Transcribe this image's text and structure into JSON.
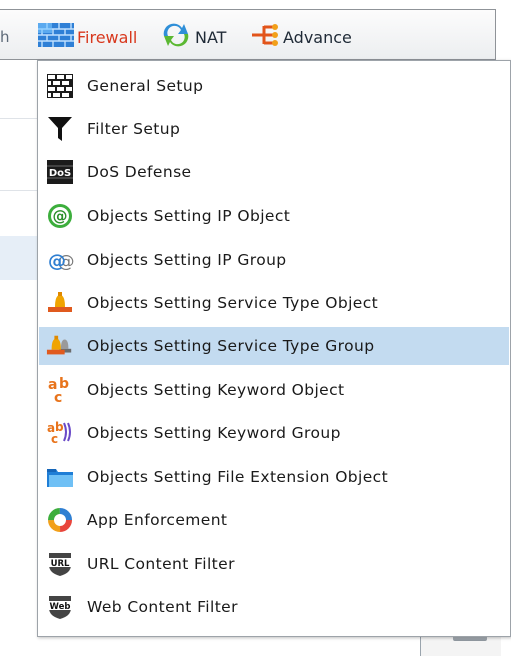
{
  "toolbar": {
    "cut_text": "h",
    "items": [
      {
        "label": "Firewall",
        "icon": "firewall-brick-icon",
        "color": "#d8381d"
      },
      {
        "label": "NAT",
        "icon": "nat-arrows-icon"
      },
      {
        "label": "Advance",
        "icon": "advance-network-icon"
      }
    ]
  },
  "menu": {
    "highlight_color": "#c3dbf0",
    "items": [
      {
        "label": "General Setup",
        "icon": "brick-wall-icon"
      },
      {
        "label": "Filter Setup",
        "icon": "funnel-icon"
      },
      {
        "label": "DoS Defense",
        "icon": "dos-icon"
      },
      {
        "label": "Objects Setting IP Object",
        "icon": "at-sign-icon"
      },
      {
        "label": "Objects Setting IP Group",
        "icon": "at-group-icon"
      },
      {
        "label": "Objects Setting Service Type Object",
        "icon": "bell-icon"
      },
      {
        "label": "Objects Setting Service Type Group",
        "icon": "bell-group-icon",
        "highlighted": true
      },
      {
        "label": "Objects Setting Keyword Object",
        "icon": "abc-icon"
      },
      {
        "label": "Objects Setting Keyword Group",
        "icon": "abc-group-icon"
      },
      {
        "label": "Objects Setting File Extension Object",
        "icon": "folder-icon"
      },
      {
        "label": "App Enforcement",
        "icon": "ring-icon"
      },
      {
        "label": "URL Content Filter",
        "icon": "url-shield-icon"
      },
      {
        "label": "Web Content Filter",
        "icon": "web-shield-icon"
      }
    ]
  }
}
